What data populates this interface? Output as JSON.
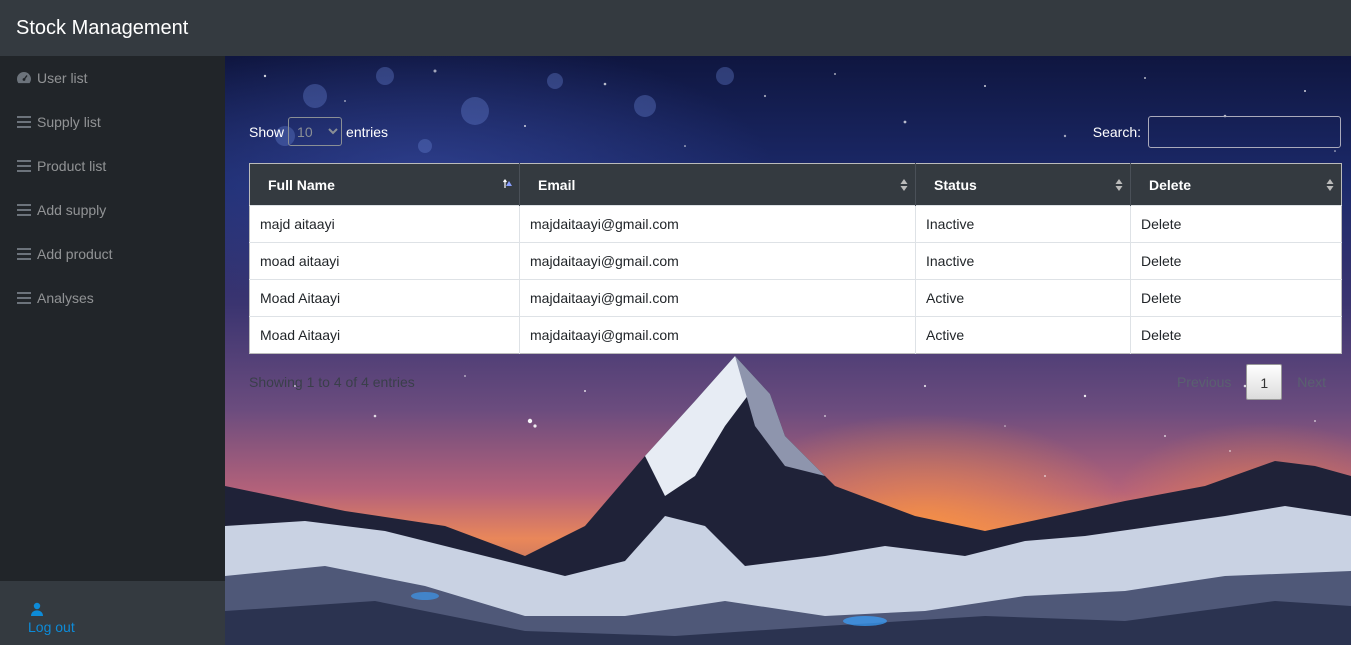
{
  "app": {
    "title": "Stock Management"
  },
  "sidebar": {
    "items": [
      {
        "label": "User list",
        "icon": "dashboard-gauge-icon"
      },
      {
        "label": "Supply list",
        "icon": "list-icon"
      },
      {
        "label": "Product list",
        "icon": "list-icon"
      },
      {
        "label": "Add supply",
        "icon": "list-icon"
      },
      {
        "label": "Add product",
        "icon": "list-icon"
      },
      {
        "label": "Analyses",
        "icon": "list-icon"
      }
    ],
    "logout": {
      "label": "Log out",
      "icon": "user-icon"
    }
  },
  "table_controls": {
    "show_label": "Show",
    "entries_label": "entries",
    "length_value": "10",
    "search_label": "Search:",
    "search_value": ""
  },
  "table": {
    "columns": [
      "Full Name",
      "Email",
      "Status",
      "Delete"
    ],
    "rows": [
      {
        "name": "majd aitaayi",
        "email": "majdaitaayi@gmail.com",
        "status": "Inactive",
        "action": "Delete"
      },
      {
        "name": "moad aitaayi",
        "email": "majdaitaayi@gmail.com",
        "status": "Inactive",
        "action": "Delete"
      },
      {
        "name": "Moad Aitaayi",
        "email": "majdaitaayi@gmail.com",
        "status": "Active",
        "action": "Delete"
      },
      {
        "name": "Moad Aitaayi",
        "email": "majdaitaayi@gmail.com",
        "status": "Active",
        "action": "Delete"
      }
    ]
  },
  "footer": {
    "info": "Showing 1 to 4 of 4 entries",
    "previous": "Previous",
    "current_page": "1",
    "next": "Next"
  },
  "colors": {
    "topbar": "#343a40",
    "sidebar": "#212529",
    "link": "#0d8bd8"
  }
}
